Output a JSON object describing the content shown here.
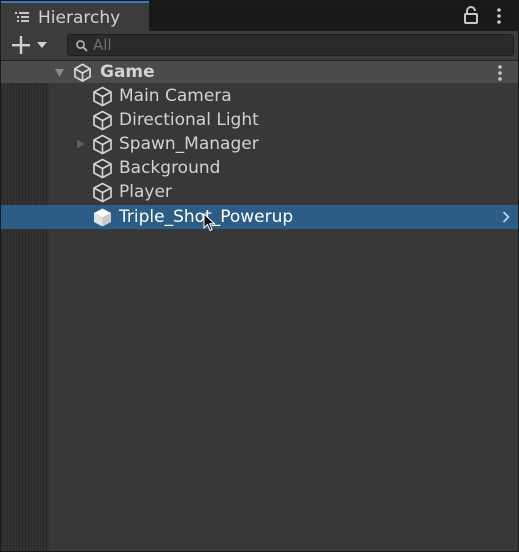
{
  "tab": {
    "title": "Hierarchy",
    "icon": "hierarchy-list-icon",
    "accent": "#3a79bb"
  },
  "toolbar": {
    "add_icon": "plus-dropdown-icon",
    "search": {
      "placeholder": "All",
      "icon": "search-icon"
    }
  },
  "scene": {
    "name": "Game",
    "icon": "unity-logo-icon",
    "expanded": true
  },
  "items": [
    {
      "label": "Main Camera",
      "icon": "gameobject-cube-icon",
      "has_children": false,
      "selected": false
    },
    {
      "label": "Directional Light",
      "icon": "gameobject-cube-icon",
      "has_children": false,
      "selected": false
    },
    {
      "label": "Spawn_Manager",
      "icon": "gameobject-cube-icon",
      "has_children": true,
      "selected": false
    },
    {
      "label": "Background",
      "icon": "gameobject-cube-icon",
      "has_children": false,
      "selected": false
    },
    {
      "label": "Player",
      "icon": "gameobject-cube-icon",
      "has_children": false,
      "selected": false
    },
    {
      "label": "Triple_Shot_Powerup",
      "icon": "gameobject-cube-icon",
      "has_children": false,
      "selected": true
    }
  ],
  "colors": {
    "selection": "#2c5d87",
    "panel": "#383838",
    "scene_header": "#4b4b4b"
  }
}
